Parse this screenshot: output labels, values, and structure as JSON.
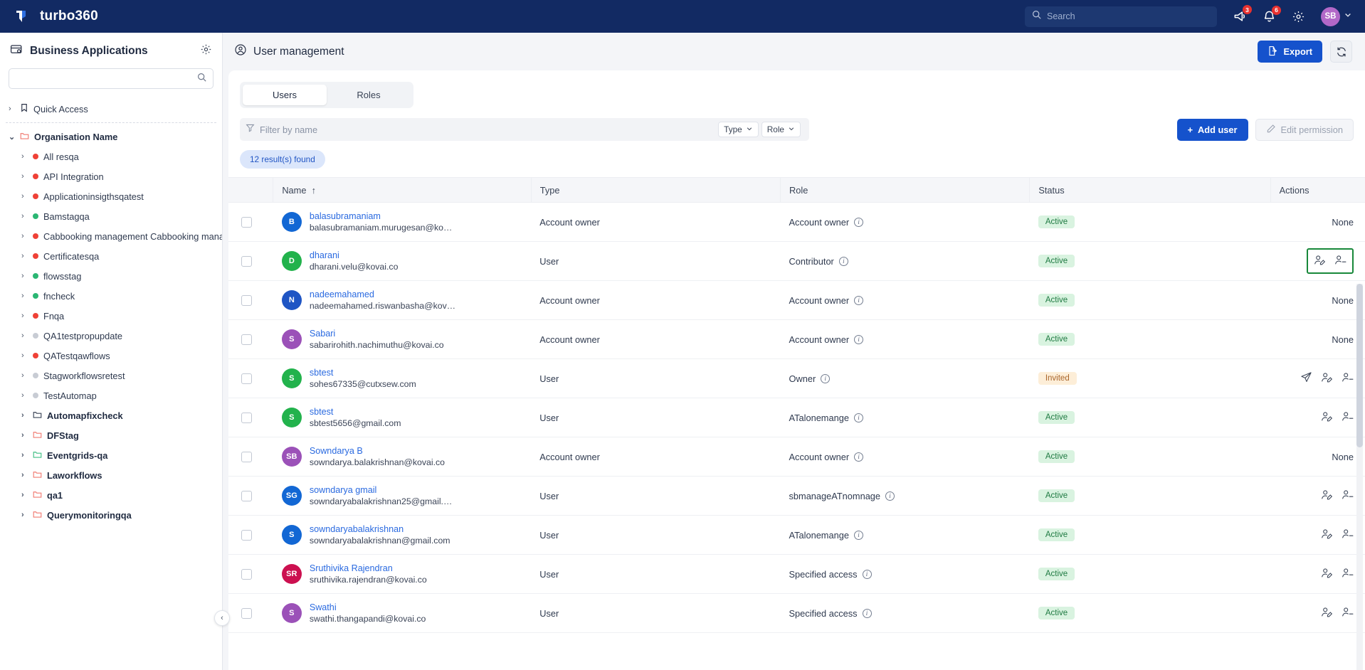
{
  "topnav": {
    "brand": "turbo360",
    "search_placeholder": "Search",
    "search_value": "",
    "announcement_badge": "3",
    "notification_badge": "6",
    "avatar_initials": "SB"
  },
  "sidebar": {
    "title": "Business Applications",
    "search_placeholder": "",
    "search_value": "",
    "quick_access": "Quick Access",
    "org": "Organisation Name",
    "apps": [
      {
        "label": "All resqa",
        "dot": "#ef4136"
      },
      {
        "label": "API Integration",
        "dot": "#ef4136"
      },
      {
        "label": "Applicationinsigthsqatest",
        "dot": "#ef4136"
      },
      {
        "label": "Bamstagqa",
        "dot": "#2bb673"
      },
      {
        "label": "Cabbooking management Cabbooking mana",
        "dot": "#ef4136"
      },
      {
        "label": "Certificatesqa",
        "dot": "#ef4136"
      },
      {
        "label": "flowsstag",
        "dot": "#2bb673"
      },
      {
        "label": "fncheck",
        "dot": "#2bb673"
      },
      {
        "label": "Fnqa",
        "dot": "#ef4136"
      },
      {
        "label": "QA1testpropupdate",
        "dot": "#c8ccd4"
      },
      {
        "label": "QATestqawflows",
        "dot": "#ef4136"
      },
      {
        "label": "Stagworkflowsretest",
        "dot": "#c8ccd4"
      },
      {
        "label": "TestAutomap",
        "dot": "#c8ccd4"
      }
    ],
    "folders": [
      {
        "label": "Automapfixcheck",
        "color": "#3a4456"
      },
      {
        "label": "DFStag",
        "color": "#f07b72"
      },
      {
        "label": "Eventgrids-qa",
        "color": "#3fbf83"
      },
      {
        "label": "Laworkflows",
        "color": "#f07b72"
      },
      {
        "label": "qa1",
        "color": "#f07b72"
      },
      {
        "label": "Querymonitoringqa",
        "color": "#f07b72"
      }
    ]
  },
  "main": {
    "page_title": "User management",
    "export_label": "Export",
    "tabs": [
      {
        "label": "Users",
        "active": true
      },
      {
        "label": "Roles",
        "active": false
      }
    ],
    "filter_placeholder": "Filter by name",
    "filter_value": "",
    "type_filter": "Type",
    "role_filter": "Role",
    "add_user_label": "Add user",
    "edit_permission_label": "Edit permission",
    "result_count": "12 result(s) found",
    "columns": [
      "",
      "Name",
      "Type",
      "Role",
      "Status",
      "Actions"
    ],
    "sort_column": "Name",
    "sort_dir": "asc"
  },
  "colors": {
    "brand_navy": "#122a63",
    "accent_blue": "#1552cc",
    "link_blue": "#2a6ae0",
    "status_active_bg": "#d9f3e0",
    "status_active_fg": "#1f7a42",
    "status_invited_bg": "#fdeed8",
    "status_invited_fg": "#a9652b",
    "highlight_border": "#18883a"
  },
  "rows": [
    {
      "initials": "B",
      "avatar_color": "#1267d4",
      "name": "balasubramaniam",
      "email": "balasubramaniam.murugesan@ko…",
      "type": "Account owner",
      "role": "Account owner",
      "status": "Active",
      "actions": "none"
    },
    {
      "initials": "D",
      "avatar_color": "#22b24c",
      "name": "dharani",
      "email": "dharani.velu@kovai.co",
      "type": "User",
      "role": "Contributor",
      "status": "Active",
      "actions": "edit-remove",
      "highlight": true
    },
    {
      "initials": "N",
      "avatar_color": "#1f55c4",
      "name": "nadeemahamed",
      "email": "nadeemahamed.riswanbasha@kov…",
      "type": "Account owner",
      "role": "Account owner",
      "status": "Active",
      "actions": "none"
    },
    {
      "initials": "S",
      "avatar_color": "#9b51b8",
      "name": "Sabari",
      "email": "sabarirohith.nachimuthu@kovai.co",
      "type": "Account owner",
      "role": "Account owner",
      "status": "Active",
      "actions": "none"
    },
    {
      "initials": "S",
      "avatar_color": "#22b24c",
      "name": "sbtest",
      "email": "sohes67335@cutxsew.com",
      "type": "User",
      "role": "Owner",
      "status": "Invited",
      "actions": "resend-edit-remove"
    },
    {
      "initials": "S",
      "avatar_color": "#22b24c",
      "name": "sbtest",
      "email": "sbtest5656@gmail.com",
      "type": "User",
      "role": "ATalonemange",
      "status": "Active",
      "actions": "edit-remove"
    },
    {
      "initials": "SB",
      "avatar_color": "#9b51b8",
      "name": "Sowndarya B",
      "email": "sowndarya.balakrishnan@kovai.co",
      "type": "Account owner",
      "role": "Account owner",
      "status": "Active",
      "actions": "none"
    },
    {
      "initials": "SG",
      "avatar_color": "#1267d4",
      "name": "sowndarya gmail",
      "email": "sowndaryabalakrishnan25@gmail.…",
      "type": "User",
      "role": "sbmanageATnomnage",
      "status": "Active",
      "actions": "edit-remove"
    },
    {
      "initials": "S",
      "avatar_color": "#1267d4",
      "name": "sowndaryabalakrishnan",
      "email": "sowndaryabalakrishnan@gmail.com",
      "type": "User",
      "role": "ATalonemange",
      "status": "Active",
      "actions": "edit-remove"
    },
    {
      "initials": "SR",
      "avatar_color": "#cc1050",
      "name": "Sruthivika Rajendran",
      "email": "sruthivika.rajendran@kovai.co",
      "type": "User",
      "role": "Specified access",
      "status": "Active",
      "actions": "edit-remove"
    },
    {
      "initials": "S",
      "avatar_color": "#9b51b8",
      "name": "Swathi",
      "email": "swathi.thangapandi@kovai.co",
      "type": "User",
      "role": "Specified access",
      "status": "Active",
      "actions": "edit-remove"
    }
  ]
}
